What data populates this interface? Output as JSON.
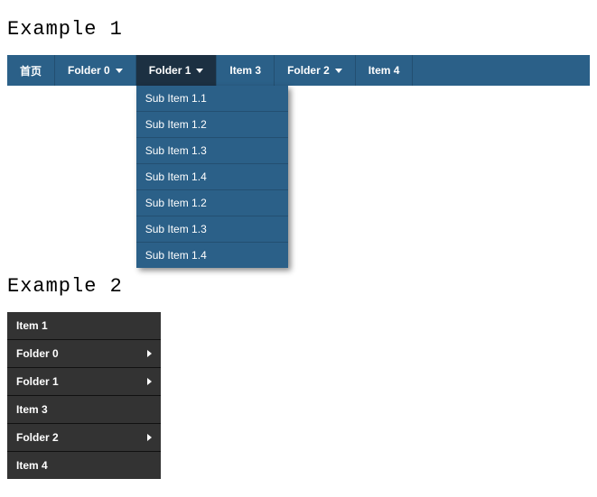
{
  "example1": {
    "heading": "Example 1",
    "nav": {
      "items": [
        {
          "label": "首页",
          "has_submenu": false,
          "active": false
        },
        {
          "label": "Folder 0",
          "has_submenu": true,
          "active": false
        },
        {
          "label": "Folder 1",
          "has_submenu": true,
          "active": true,
          "submenu": [
            "Sub Item 1.1",
            "Sub Item 1.2",
            "Sub Item 1.3",
            "Sub Item 1.4",
            "Sub Item 1.2",
            "Sub Item 1.3",
            "Sub Item 1.4"
          ]
        },
        {
          "label": "Item 3",
          "has_submenu": false,
          "active": false
        },
        {
          "label": "Folder 2",
          "has_submenu": true,
          "active": false
        },
        {
          "label": "Item 4",
          "has_submenu": false,
          "active": false
        }
      ]
    },
    "colors": {
      "bar_bg": "#2b6088",
      "bar_border": "#234f71",
      "active_bg": "#1c3042",
      "text": "#ffffff"
    }
  },
  "example2": {
    "heading": "Example 2",
    "nav": {
      "items": [
        {
          "label": "Item 1",
          "has_submenu": false
        },
        {
          "label": "Folder 0",
          "has_submenu": true
        },
        {
          "label": "Folder 1",
          "has_submenu": true
        },
        {
          "label": "Item 3",
          "has_submenu": false
        },
        {
          "label": "Folder 2",
          "has_submenu": true
        },
        {
          "label": "Item 4",
          "has_submenu": false
        }
      ]
    },
    "colors": {
      "bg": "#333333",
      "border": "#111111",
      "text": "#ffffff"
    }
  }
}
